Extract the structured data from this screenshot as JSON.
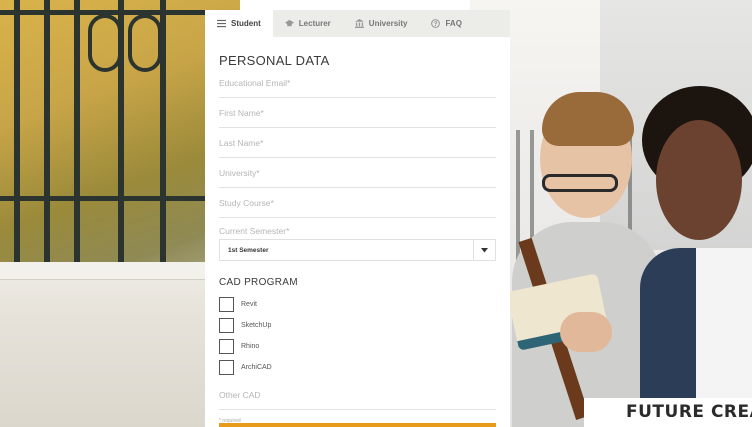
{
  "tabs": [
    {
      "label": "Student",
      "icon": "menu-icon",
      "active": true
    },
    {
      "label": "Lecturer",
      "icon": "graduation-cap-icon",
      "active": false
    },
    {
      "label": "University",
      "icon": "university-building-icon",
      "active": false
    },
    {
      "label": "FAQ",
      "icon": "question-circle-icon",
      "active": false
    }
  ],
  "form": {
    "section_title": "PERSONAL DATA",
    "fields": {
      "educational_email": "Educational Email*",
      "first_name": "First Name*",
      "last_name": "Last Name*",
      "university": "University*",
      "study_course": "Study Course*"
    },
    "current_semester_label": "Current Semester*",
    "current_semester_value": "1st Semester",
    "cad_title": "CAD PROGRAM",
    "cad_options": [
      "Revit",
      "SketchUp",
      "Rhino",
      "ArchiCAD"
    ],
    "other_cad": "Other CAD",
    "required_note": "* required"
  },
  "banner": {
    "tagline": "FUTURE CREATO"
  },
  "colors": {
    "accent": "#e89a1a",
    "tab_bar": "#ecece8"
  }
}
